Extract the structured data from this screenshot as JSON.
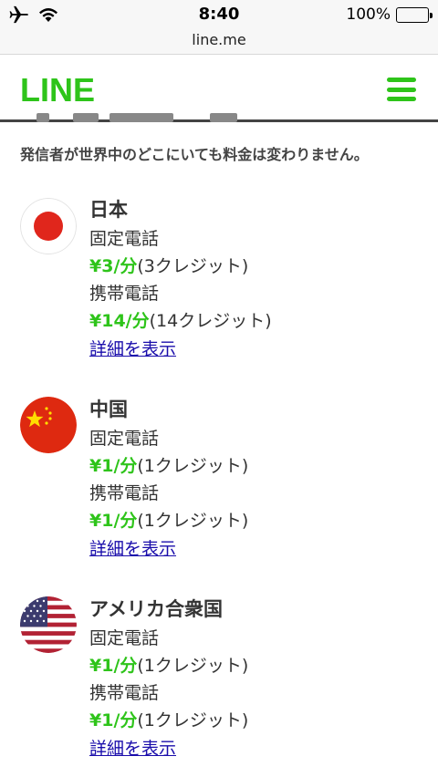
{
  "status_bar": {
    "time": "8:40",
    "battery": "100%",
    "icons": [
      "airplane-icon",
      "wifi-icon",
      "battery-icon"
    ]
  },
  "browser": {
    "url": "line.me"
  },
  "header": {
    "logo": "LINE",
    "menu_icon": "hamburger-menu-icon",
    "brand_color": "#2ec41a"
  },
  "intro": "発信者が世界中のどこにいても料金は変わりません。",
  "countries": [
    {
      "name": "日本",
      "flag_icon": "japan-flag-icon",
      "landline_label": "固定電話",
      "landline_price": "¥3/分",
      "landline_credits": "(3クレジット)",
      "mobile_label": "携帯電話",
      "mobile_price": "¥14/分",
      "mobile_credits": "(14クレジット)",
      "details_link": "詳細を表示"
    },
    {
      "name": "中国",
      "flag_icon": "china-flag-icon",
      "landline_label": "固定電話",
      "landline_price": "¥1/分",
      "landline_credits": "(1クレジット)",
      "mobile_label": "携帯電話",
      "mobile_price": "¥1/分",
      "mobile_credits": "(1クレジット)",
      "details_link": "詳細を表示"
    },
    {
      "name": "アメリカ合衆国",
      "flag_icon": "usa-flag-icon",
      "landline_label": "固定電話",
      "landline_price": "¥1/分",
      "landline_credits": "(1クレジット)",
      "mobile_label": "携帯電話",
      "mobile_price": "¥1/分",
      "mobile_credits": "(1クレジット)",
      "details_link": "詳細を表示"
    }
  ]
}
